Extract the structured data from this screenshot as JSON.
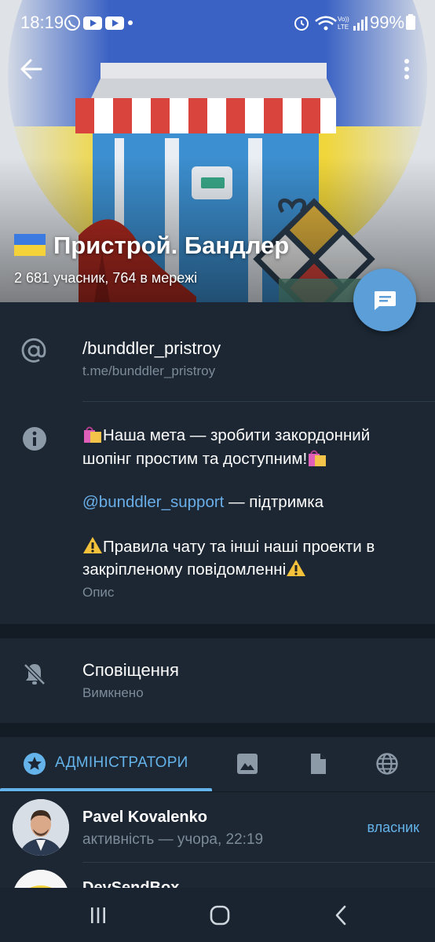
{
  "status_bar": {
    "time": "18:19",
    "battery": "99%"
  },
  "group": {
    "title": "Пристрой. Бандлер",
    "subtitle": "2 681 учасник, 764 в мережі"
  },
  "link": {
    "username": "/bunddler_pristroy",
    "url": "t.me/bunddler_pristroy"
  },
  "description": {
    "line1": "Наша мета — зробити закордонний шопінг простим та доступним!",
    "mention": "@bunddler_support",
    "mention_suffix": " — підтримка",
    "rules": "Правила чату та інші наші проекти в закріпленому повідомленні",
    "caption": "Опис"
  },
  "notifications": {
    "title": "Сповіщення",
    "value": "Вимкнено"
  },
  "tabs": {
    "admins_label": "АДМІНІСТРАТОРИ",
    "icons": [
      "star-icon",
      "image-icon",
      "file-icon",
      "globe-icon"
    ]
  },
  "members": [
    {
      "name": "Pavel Kovalenko",
      "status": "активність — учора, 22:19",
      "role": "власник"
    },
    {
      "name": "DevSendBox",
      "status": "",
      "role": ""
    }
  ],
  "colors": {
    "background": "#1c2733",
    "accent": "#64b3ea",
    "fab": "#5c9fd8",
    "secondary_text": "#7d8b99"
  }
}
